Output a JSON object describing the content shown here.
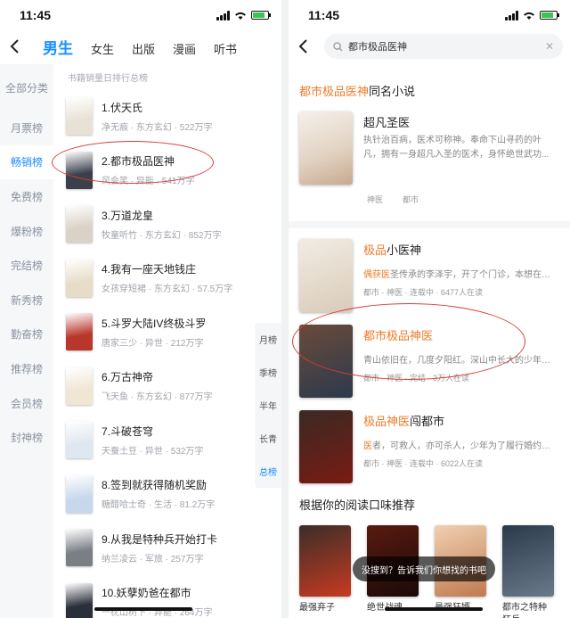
{
  "left": {
    "status": {
      "time": "11:45"
    },
    "nav": {
      "tabs": [
        "男生",
        "女生",
        "出版",
        "漫画",
        "听书"
      ]
    },
    "side_menu": [
      "全部分类",
      "月票榜",
      "畅销榜",
      "免费榜",
      "爆粉榜",
      "完结榜",
      "新秀榜",
      "勤奋榜",
      "推荐榜",
      "会员榜",
      "封神榜"
    ],
    "list_header": "书籍销量日排行总榜",
    "books": [
      {
        "title": "1.伏天氏",
        "meta": "净无痕 · 东方玄幻 · 522万字"
      },
      {
        "title": "2.都市极品医神",
        "meta": "风会笑 · 异能 · 541万字"
      },
      {
        "title": "3.万道龙皇",
        "meta": "牧童听竹 · 东方玄幻 · 852万字"
      },
      {
        "title": "4.我有一座天地钱庄",
        "meta": "女孩穿短裙 · 东方玄幻 · 57.5万字"
      },
      {
        "title": "5.斗罗大陆IV终极斗罗",
        "meta": "唐家三少 · 异世 · 212万字"
      },
      {
        "title": "6.万古神帝",
        "meta": "飞天鱼 · 东方玄幻 · 877万字"
      },
      {
        "title": "7.斗破苍穹",
        "meta": "天蚕土豆 · 异世 · 532万字"
      },
      {
        "title": "8.签到就获得随机奖励",
        "meta": "糖醋哈士奇 · 生活 · 81.2万字"
      },
      {
        "title": "9.从我是特种兵开始打卡",
        "meta": "纳兰凌云 · 军旅 · 257万字"
      },
      {
        "title": "10.妖孽奶爸在都市",
        "meta": "一枕山树下 · 异能 · 264万字"
      }
    ],
    "rank_tabs": [
      "月榜",
      "季榜",
      "半年",
      "长青",
      "总榜"
    ],
    "cover_colors": [
      "#e8e2d6",
      "#3a3f4a",
      "#d9d2c6",
      "#e6dcc8",
      "#b8362a",
      "#efe6d4",
      "#dfe8f0",
      "#c8d8ec",
      "#7a7f86",
      "#2a2f3a"
    ]
  },
  "right": {
    "status": {
      "time": "11:45"
    },
    "search": {
      "query": "都市极品医神"
    },
    "same_name": {
      "title_hl": "都市极品医神",
      "title_rest": "同名小说"
    },
    "featured": {
      "title": "超凡圣医",
      "desc1": "执针治百病，医术可称神。奉命下山寻药的叶",
      "desc2": "凡，拥有一身超凡入圣的医术，身怀绝世武功...",
      "tags": [
        "神医",
        "都市"
      ]
    },
    "results": [
      {
        "title_hl": "极品",
        "title_rest": "小医神",
        "desc_hl": "偶获医",
        "desc": "圣传承的李泽宇，开了个门诊，本想在门诊...",
        "meta": "都市 · 神医 · 连载中 · 6477人在读"
      },
      {
        "title_hl": "都市极品神医",
        "title_rest": "",
        "desc_hl": "",
        "desc": "青山依旧在，几度夕阳红。深山中长大的少年，酒...",
        "meta": "都市 · 神医 · 完结 · 3万人在读"
      },
      {
        "title_hl": "极品神医",
        "title_rest": "闯都市",
        "desc_hl": "医",
        "desc": "者，可救人，亦可杀人，少年为了履行婚约而从...",
        "meta": "都市 · 神医 · 连载中 · 6022人在读"
      }
    ],
    "recommend_title": "根据你的阅读口味推荐",
    "recommend": [
      "最强弃子",
      "绝世战魂",
      "最强狂婿",
      "都市之特种狂兵"
    ],
    "toast": "没搜到？告诉我们你想找的书吧",
    "cover_colors": [
      "#f2ece4",
      "#d9cbb8",
      "#6a4a3a",
      "#2c3a4c",
      "#3a2a24",
      "#7a1a14",
      "#e8b080",
      "#3c3f46"
    ]
  }
}
